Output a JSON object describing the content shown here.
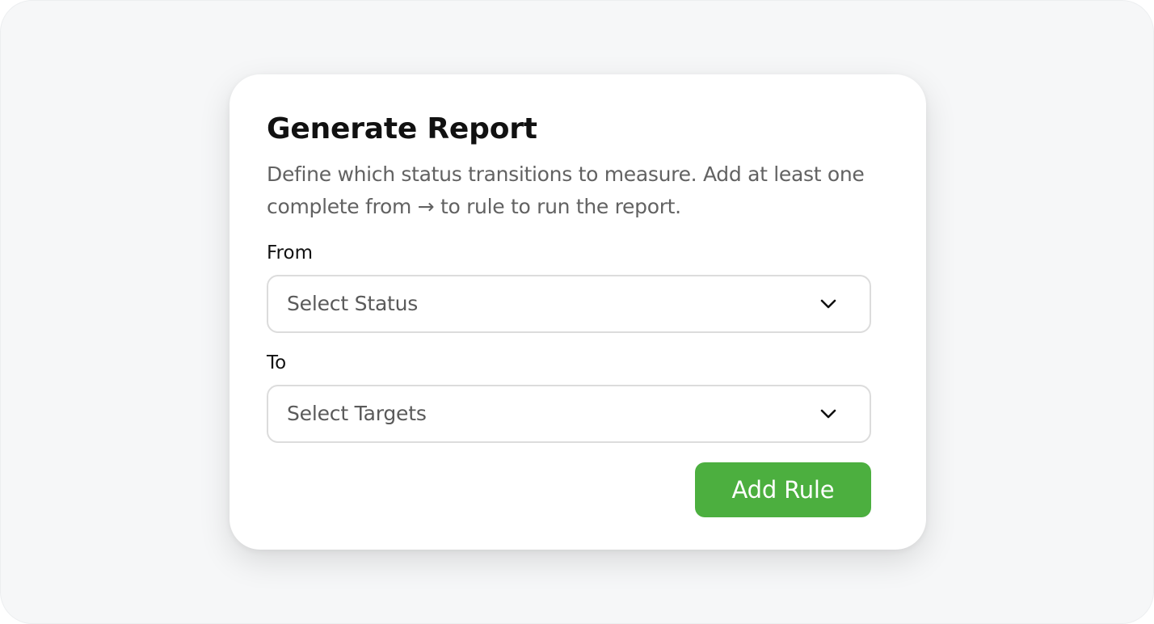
{
  "dialog": {
    "title": "Generate Report",
    "description": "Define which status transitions to measure. Add at least one complete from → to rule to run the report."
  },
  "form": {
    "from": {
      "label": "From",
      "placeholder": "Select Status",
      "icon": "chevron-down-icon"
    },
    "to": {
      "label": "To",
      "placeholder": "Select Targets",
      "icon": "chevron-down-icon"
    },
    "add_rule_label": "Add Rule"
  },
  "colors": {
    "accent": "#4caf3f",
    "title": "#111111",
    "muted_text": "#626262",
    "border": "#dcdcdc",
    "backdrop": "#f6f7f8"
  }
}
